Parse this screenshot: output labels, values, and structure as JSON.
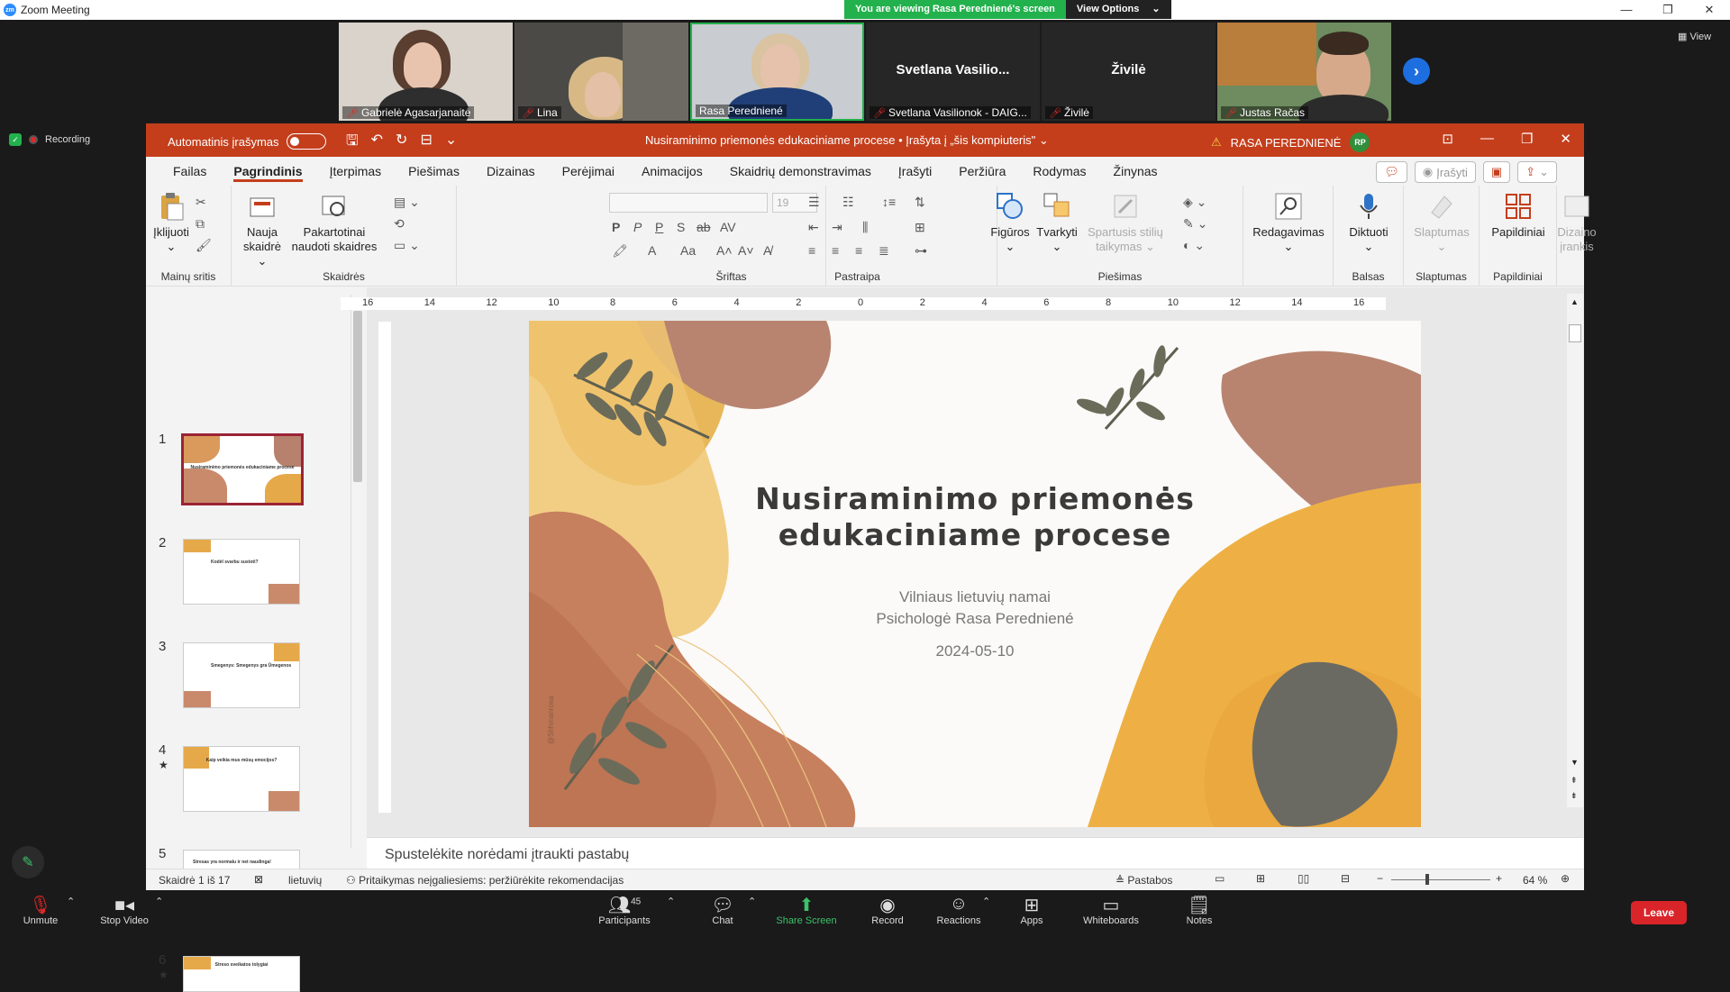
{
  "zoom": {
    "window_title": "Zoom Meeting",
    "banner_viewing": "You are viewing Rasa Peredniené's screen",
    "banner_view_options": "View Options",
    "view_label": "View",
    "recording_label": "Recording",
    "participants": [
      {
        "name": "Gabrielė Agasarjanaitė"
      },
      {
        "name": "Lina"
      },
      {
        "name": "Rasa Peredniené"
      },
      {
        "name": "Svetlana Vasilionok - DAIG...",
        "big_label": "Svetlana  Vasilio..."
      },
      {
        "name": "Živilė",
        "big_label": "Živilė"
      },
      {
        "name": "Justas Račas"
      }
    ],
    "toolbar": {
      "unmute": "Unmute",
      "stop_video": "Stop Video",
      "participants": "Participants",
      "participants_count": "45",
      "chat": "Chat",
      "share_screen": "Share Screen",
      "record": "Record",
      "reactions": "Reactions",
      "apps": "Apps",
      "whiteboards": "Whiteboards",
      "notes": "Notes",
      "leave": "Leave"
    }
  },
  "ppt": {
    "autosave_label": "Automatinis įrašymas",
    "doc_title": "Nusiraminimo priemonės edukaciniame procese  •  Įrašyta į „šis kompiuteris\"",
    "user_name": "RASA PEREDNIENĖ",
    "user_initials": "RP",
    "tabs": [
      "Failas",
      "Pagrindinis",
      "Įterpimas",
      "Piešimas",
      "Dizainas",
      "Perėjimai",
      "Animacijos",
      "Skaidrių demonstravimas",
      "Įrašyti",
      "Peržiūra",
      "Rodymas",
      "Žinynas"
    ],
    "record_btn": "Įrašyti",
    "ribbon": {
      "clipboard_paste": "Įklijuoti",
      "clipboard_group": "Mainų sritis",
      "new_slide_line1": "Nauja",
      "new_slide_line2": "skaidrė",
      "reuse_line1": "Pakartotinai",
      "reuse_line2": "naudoti skaidres",
      "slides_group": "Skaidrės",
      "font_size": "19",
      "font_group": "Šriftas",
      "paragraph_group": "Pastraipa",
      "shapes": "Figūros",
      "arrange": "Tvarkyti",
      "quick_styles_line1": "Spartusis stilių",
      "quick_styles_line2": "taikymas",
      "drawing_group": "Piešimas",
      "editing": "Redagavimas",
      "dictate": "Diktuoti",
      "voice_group": "Balsas",
      "sensitivity": "Slaptumas",
      "sensitivity_group": "Slaptumas",
      "addins": "Papildiniai",
      "addins_group": "Papildiniai",
      "designer_line1": "Dizaino",
      "designer_line2": "įrankis"
    },
    "thumbnails": [
      {
        "num": "1",
        "title": "Nusiraminimo priemonės edukaciniame procese",
        "star": ""
      },
      {
        "num": "2",
        "title": "Kodėl svarbu sustoti?",
        "star": ""
      },
      {
        "num": "3",
        "title": "Smegenys: Smegenys gra Ūmegenos",
        "star": ""
      },
      {
        "num": "4",
        "title": "Kaip veikia mus mūsų emocijos?",
        "star": "★"
      },
      {
        "num": "5",
        "title": "Stresas yra normalu ir net naudinga!",
        "star": ""
      },
      {
        "num": "6",
        "title": "Streso sveikatos tolygiai",
        "star": "★"
      }
    ],
    "ruler_labels": [
      "16",
      "14",
      "12",
      "10",
      "8",
      "6",
      "4",
      "2",
      "0",
      "2",
      "4",
      "6",
      "8",
      "10",
      "12",
      "14",
      "16"
    ],
    "slide": {
      "title_line1": "Nusiraminimo priemonės",
      "title_line2": "edukaciniame procese",
      "org": "Vilniaus lietuvių namai",
      "author": "Psichologė Rasa Peredniené",
      "date": "2024-05-10",
      "watermark": "@Shhmanrosa"
    },
    "notes_placeholder": "Spustelėkite norėdami įtraukti pastabų",
    "status": {
      "slide_count": "Skaidrė 1 iš 17",
      "language": "lietuvių",
      "accessibility": "Pritaikymas neįgaliesiems: peržiūrėkite rekomendacijas",
      "notes": "Pastabos",
      "zoom": "64 %"
    }
  }
}
